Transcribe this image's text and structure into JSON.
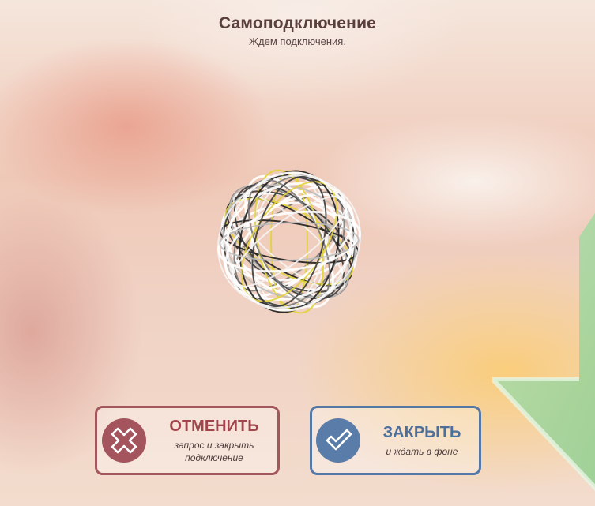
{
  "header": {
    "title": "Самоподключение",
    "subtitle": "Ждем подключения."
  },
  "spinner": {
    "icon": "wire-sphere-spinner"
  },
  "buttons": {
    "cancel": {
      "label": "ОТМЕНИТЬ",
      "sub_line1": "запрос и закрыть",
      "sub_line2": "подключение",
      "icon": "x-circle-icon",
      "color": "#a1454d"
    },
    "close": {
      "label": "ЗАКРЫТЬ",
      "sub_line1": "и ждать в фоне",
      "icon": "check-circle-icon",
      "color": "#4d6f9c"
    }
  },
  "colors": {
    "background_accent": "#f0c9b8",
    "arrow_green": "#9fd39a"
  }
}
